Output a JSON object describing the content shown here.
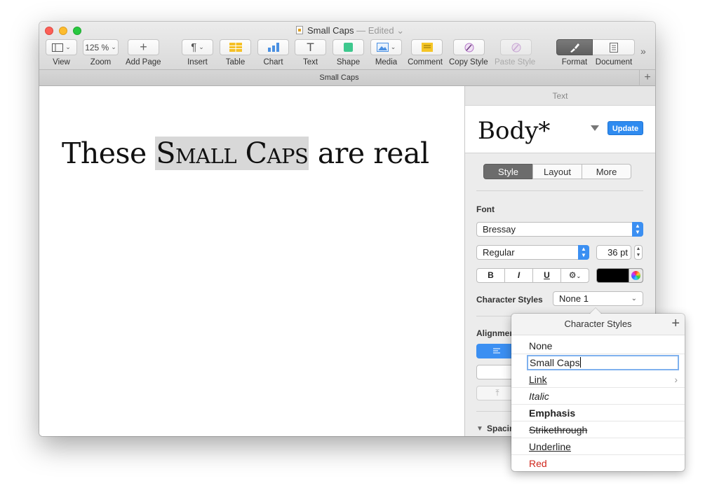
{
  "window": {
    "title": "Small Caps",
    "title_status": "— Edited",
    "title_chevron": "⌄"
  },
  "toolbar": {
    "view_label": "View",
    "zoom_value": "125 %",
    "zoom_label": "Zoom",
    "add_page_label": "Add Page",
    "insert_label": "Insert",
    "table_label": "Table",
    "chart_label": "Chart",
    "text_label": "Text",
    "shape_label": "Shape",
    "media_label": "Media",
    "comment_label": "Comment",
    "copy_style_label": "Copy Style",
    "paste_style_label": "Paste Style",
    "format_label": "Format",
    "document_label": "Document",
    "overflow": "»"
  },
  "tabbar": {
    "title": "Small Caps",
    "plus": "+"
  },
  "document": {
    "text_before": "These ",
    "text_selected": "Small Caps",
    "text_after": " are real"
  },
  "inspector": {
    "header": "Text",
    "paragraph_style": "Body*",
    "update_label": "Update",
    "tabs": [
      "Style",
      "Layout",
      "More"
    ],
    "active_tab": "Style",
    "font_section": "Font",
    "font_family": "Bressay",
    "font_typeface": "Regular",
    "font_size": "36 pt",
    "format_buttons": [
      "B",
      "I",
      "U",
      "⚙"
    ],
    "text_color": "#000000",
    "character_styles_label": "Character Styles",
    "character_style_value": "None 1",
    "alignment_label": "Alignmer",
    "spacing_label": "Spacin"
  },
  "character_styles_popover": {
    "title": "Character Styles",
    "plus": "+",
    "items": [
      {
        "label": "None"
      },
      {
        "label": "Small Caps"
      },
      {
        "label": "Link"
      },
      {
        "label": "Italic"
      },
      {
        "label": "Emphasis"
      },
      {
        "label": "Strikethrough"
      },
      {
        "label": "Underline"
      },
      {
        "label": "Red"
      }
    ]
  },
  "colors": {
    "accent": "#2f8bf0",
    "red_style": "#d0271d",
    "selection": "#d8d8d8"
  }
}
